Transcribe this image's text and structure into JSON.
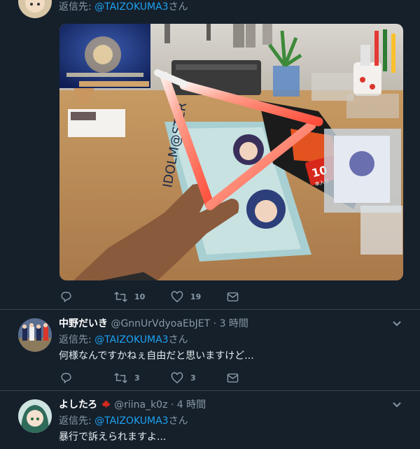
{
  "tweet1": {
    "reply_prefix": "返信先: ",
    "reply_mention": "@TAIZOKUMA3",
    "reply_suffix": "さん",
    "actions": {
      "reply_count": "",
      "retweet_count": "10",
      "like_count": "19"
    }
  },
  "tweet2": {
    "name": "中野だいき",
    "handle": "@GnnUrVdyoaEbJET",
    "dot": "·",
    "time": "3 時間",
    "reply_prefix": "返信先: ",
    "reply_mention": "@TAIZOKUMA3",
    "reply_suffix": "さん",
    "text": "何様なんですかねぇ自由だと思いますけど...",
    "actions": {
      "retweet_count": "3",
      "like_count": "3"
    }
  },
  "tweet3": {
    "name": "よしたろ",
    "handle": "@riina_k0z",
    "dot": "·",
    "time": "4 時間",
    "reply_prefix": "返信先: ",
    "reply_mention": "@TAIZOKUMA3",
    "reply_suffix": "さん",
    "text": "暴行で訴えられますよ..."
  },
  "photo": {
    "glowstick_pack_count": "10",
    "glowstick_pack_unit": "本入り"
  },
  "colors": {
    "background": "#15202b",
    "divider": "#38444d",
    "mention": "#1da1f2",
    "secondary_text": "#8899a6"
  }
}
